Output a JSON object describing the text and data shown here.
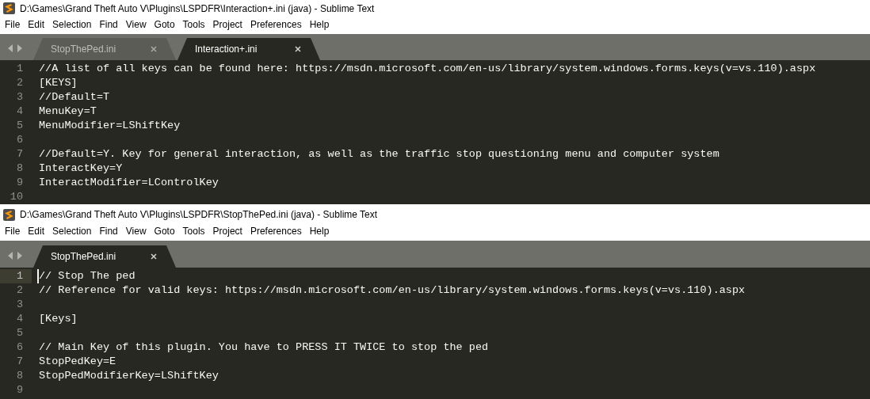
{
  "windows": [
    {
      "title": "D:\\Games\\Grand Theft Auto V\\Plugins\\LSPDFR\\Interaction+.ini (java) - Sublime Text",
      "menu": [
        "File",
        "Edit",
        "Selection",
        "Find",
        "View",
        "Goto",
        "Tools",
        "Project",
        "Preferences",
        "Help"
      ],
      "tabs": [
        {
          "label": "StopThePed.ini",
          "selected": false
        },
        {
          "label": "Interaction+.ini",
          "selected": true
        }
      ],
      "lines": [
        {
          "number": "1",
          "text": "//A list of all keys can be found here: https://msdn.microsoft.com/en-us/library/system.windows.forms.keys(v=vs.110).aspx",
          "current": false
        },
        {
          "number": "2",
          "text": "[KEYS]",
          "current": false
        },
        {
          "number": "3",
          "text": "//Default=T",
          "current": false
        },
        {
          "number": "4",
          "text": "MenuKey=T",
          "current": false
        },
        {
          "number": "5",
          "text": "MenuModifier=LShiftKey",
          "current": false
        },
        {
          "number": "6",
          "current": false
        },
        {
          "number": "7",
          "text": "//Default=Y. Key for general interaction, as well as the traffic stop questioning menu and computer system",
          "current": false
        },
        {
          "number": "8",
          "text": "InteractKey=Y",
          "current": false
        },
        {
          "number": "9",
          "text": "InteractModifier=LControlKey",
          "current": false
        },
        {
          "number": "10",
          "current": false
        }
      ]
    },
    {
      "title": "D:\\Games\\Grand Theft Auto V\\Plugins\\LSPDFR\\StopThePed.ini (java) - Sublime Text",
      "menu": [
        "File",
        "Edit",
        "Selection",
        "Find",
        "View",
        "Goto",
        "Tools",
        "Project",
        "Preferences",
        "Help"
      ],
      "tabs": [
        {
          "label": "StopThePed.ini",
          "selected": true
        }
      ],
      "lines": [
        {
          "number": "1",
          "text": "// Stop The ped",
          "current": true
        },
        {
          "number": "2",
          "text": "// Reference for valid keys: https://msdn.microsoft.com/en-us/library/system.windows.forms.keys(v=vs.110).aspx",
          "current": false
        },
        {
          "number": "3",
          "current": false
        },
        {
          "number": "4",
          "text": "[Keys]",
          "current": false
        },
        {
          "number": "5",
          "current": false
        },
        {
          "number": "6",
          "text": "// Main Key of this plugin. You have to PRESS IT TWICE to stop the ped",
          "current": false
        },
        {
          "number": "7",
          "text": "StopPedKey=E",
          "current": false
        },
        {
          "number": "8",
          "text": "StopPedModifierKey=LShiftKey",
          "current": false
        },
        {
          "number": "9",
          "current": false
        }
      ]
    }
  ]
}
